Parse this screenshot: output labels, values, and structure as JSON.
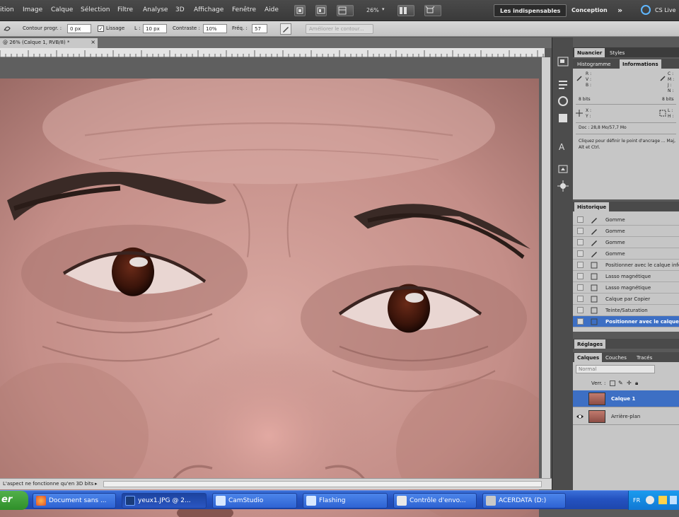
{
  "menubar": {
    "items": [
      "ition",
      "Image",
      "Calque",
      "Sélection",
      "Filtre",
      "Analyse",
      "3D",
      "Affichage",
      "Fenêtre",
      "Aide"
    ],
    "zoom": "26%",
    "workspace_active": "Les indispensables",
    "workspace_other": "Conception",
    "more": "»",
    "cslive": "CS Live"
  },
  "options": {
    "contour_label": "Contour progr. :",
    "contour_value": "0 px",
    "lissage_label": "Lissage",
    "largeur_label": "L :",
    "largeur_value": "10 px",
    "contraste_label": "Contraste :",
    "contraste_value": "10%",
    "freq_label": "Fréq. :",
    "freq_value": "57",
    "ameliorer_label": "Améliorer le contour..."
  },
  "document": {
    "tab_title": "@ 26% (Calque 1, RVB/8) *",
    "status_text": "L'aspect ne fonctionne qu'en 3D bits"
  },
  "panels": {
    "top_tabs": [
      "Nuancier",
      "Styles"
    ],
    "info_tabs": [
      "Histogramme",
      "Informations"
    ],
    "info_rgb_labels": [
      "R :",
      "V :",
      "B :"
    ],
    "info_cmyk_labels": [
      "C :",
      "M :",
      "J :",
      "N :"
    ],
    "info_bits": "8 bits",
    "info_xy": [
      "X :",
      "Y :"
    ],
    "info_wh": [
      "L :",
      "H :"
    ],
    "doc_size": "Doc : 28,8 Mo/57,7 Mo",
    "hint": "Cliquez pour définir le point d'ancrage ... Maj, Alt et Ctrl.",
    "history_tab": "Historique",
    "history": [
      "Gomme",
      "Gomme",
      "Gomme",
      "Gomme",
      "Positionner avec le calque infé...",
      "Lasso magnétique",
      "Lasso magnétique",
      "Calque par Copier",
      "Teinte/Saturation",
      "Positionner avec le calque inf..."
    ],
    "reglages_tab": "Réglages",
    "layers_tabs": [
      "Calques",
      "Couches",
      "Tracés"
    ],
    "blend_mode": "Normal",
    "lock_label": "Verr. :",
    "layers": [
      "Calque 1",
      "Arrière-plan"
    ]
  },
  "taskbar": {
    "start": "er",
    "tasks": [
      "Document sans ...",
      "yeux1.JPG @ 2...",
      "CamStudio",
      "Flashing",
      "Contrôle d'envo...",
      "ACERDATA (D:)"
    ],
    "lang": "FR"
  },
  "colors": {
    "accent": "#3d6fc4",
    "taskbar": "#2452c0"
  }
}
